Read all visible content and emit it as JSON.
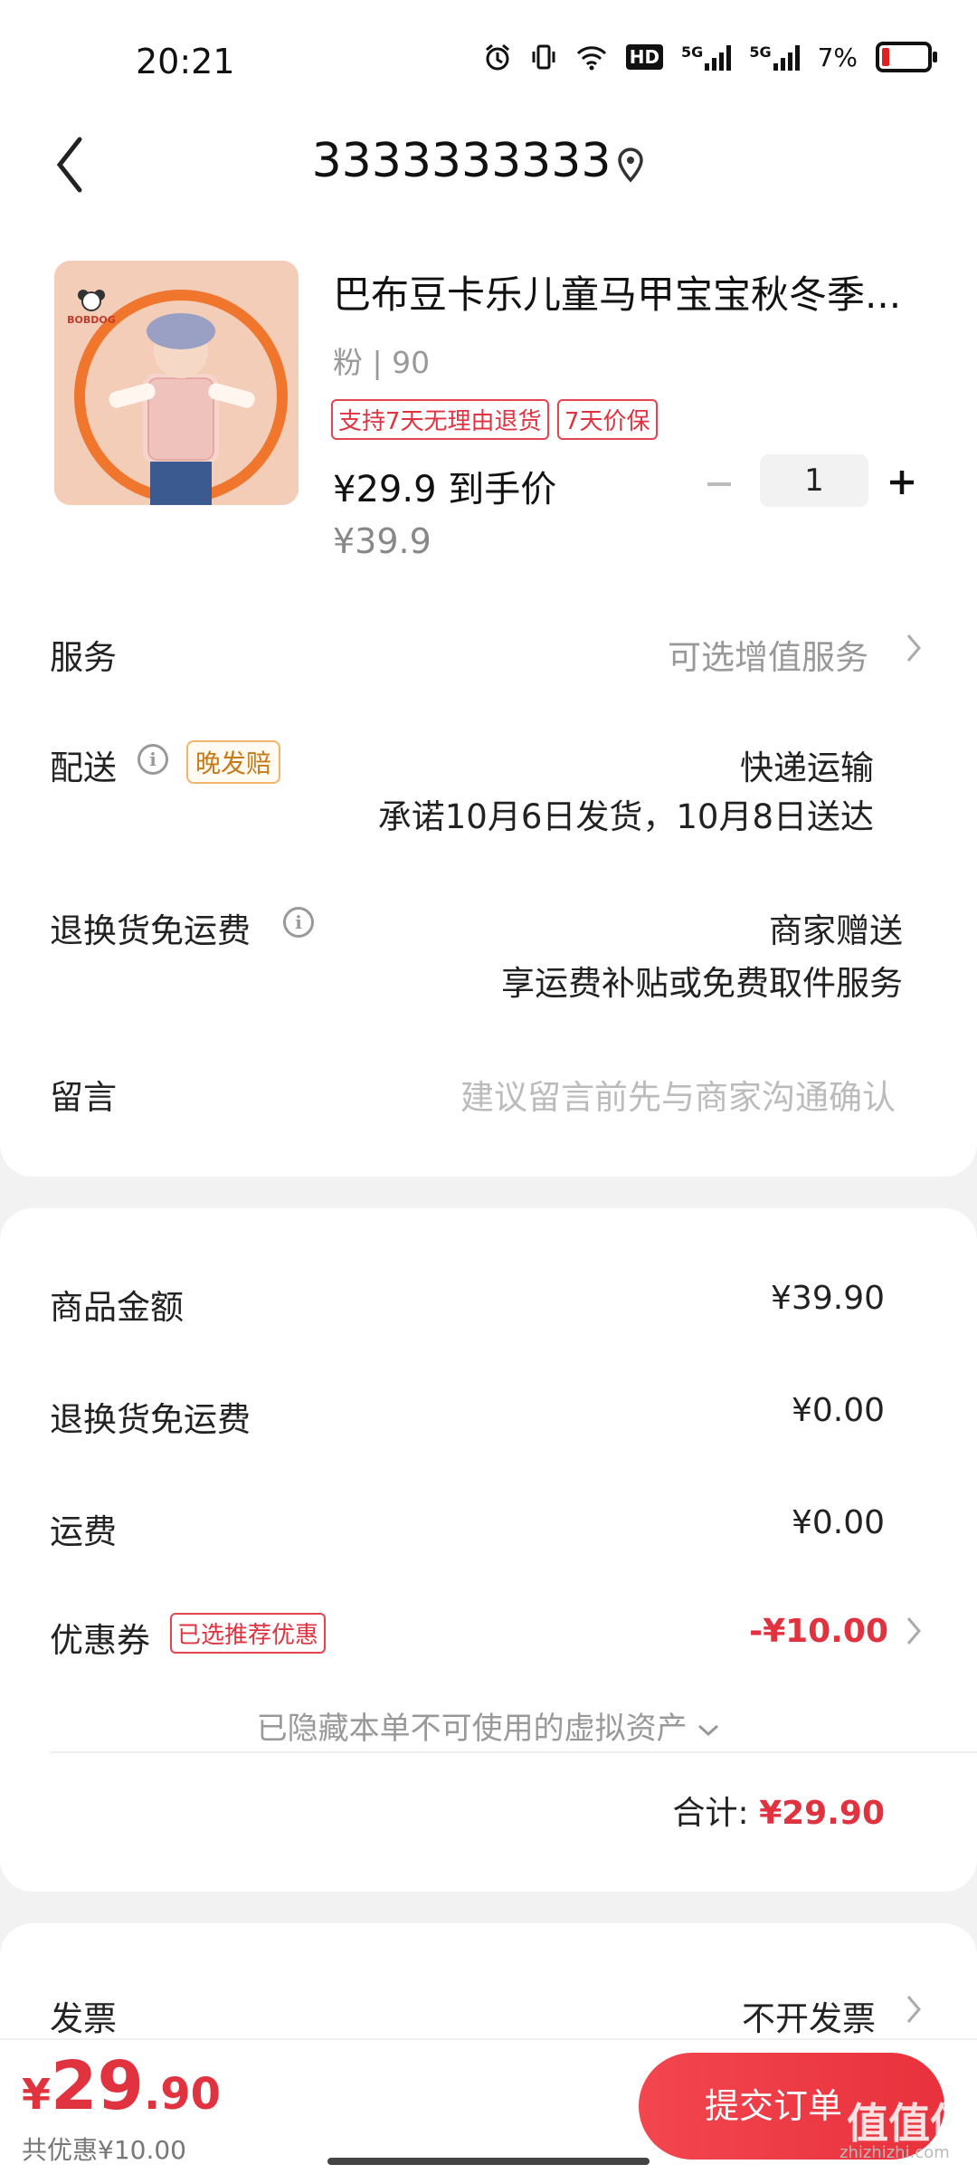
{
  "status": {
    "time": "20:21",
    "network_hd": "HD",
    "sim1": "5G",
    "sim2": "5G",
    "battery": "7%",
    "battery_level": 0.07
  },
  "header": {
    "title": "3333333333"
  },
  "product": {
    "title": "巴布豆卡乐儿童马甲宝宝秋冬季...",
    "spec": "粉 | 90",
    "tags": [
      "支持7天无理由退货",
      "7天价保"
    ],
    "final_price": "¥29.9 到手价",
    "original_price": "¥39.9",
    "quantity": "1",
    "brand_logo": "BOBDOG"
  },
  "rows": {
    "service_label": "服务",
    "service_value": "可选增值服务",
    "delivery_label": "配送",
    "delivery_badge": "晚发赔",
    "delivery_method": "快递运输",
    "delivery_promise": "承诺10月6日发货，10月8日送达",
    "return_label": "退换货免运费",
    "return_value1": "商家赠送",
    "return_value2": "享运费补贴或免费取件服务",
    "message_label": "留言",
    "message_placeholder": "建议留言前先与商家沟通确认"
  },
  "summary": {
    "goods_label": "商品金额",
    "goods_value": "¥39.90",
    "return_fee_label": "退换货免运费",
    "return_fee_value": "¥0.00",
    "shipping_label": "运费",
    "shipping_value": "¥0.00",
    "coupon_label": "优惠券",
    "coupon_badge": "已选推荐优惠",
    "coupon_value": "-¥10.00",
    "hidden_assets": "已隐藏本单不可使用的虚拟资产",
    "total_label": "合计:",
    "total_value": "¥29.90"
  },
  "invoice": {
    "label": "发票",
    "value": "不开发票"
  },
  "bottom": {
    "currency": "¥",
    "price_int": "29",
    "price_dec": ".90",
    "discount": "共优惠¥10.00",
    "submit_label": "提交订单"
  },
  "watermark": {
    "text": "值值值",
    "sub": "zhizhizhi.com"
  },
  "colors": {
    "accent": "#e0323f",
    "badge_orange": "#c77a18",
    "background": "#f2f2f2"
  }
}
